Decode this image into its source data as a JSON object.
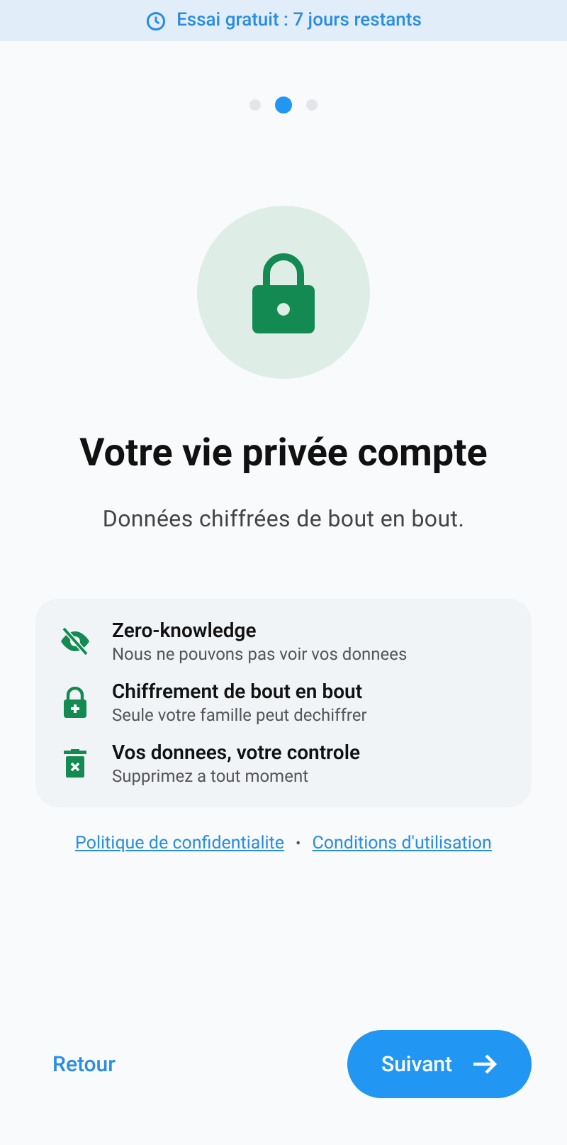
{
  "trial_banner": {
    "text": "Essai gratuit : 7 jours restants"
  },
  "pager": [
    {
      "selected": false
    },
    {
      "selected": true
    },
    {
      "selected": false
    }
  ],
  "title": "Votre vie privée compte",
  "subtitle": "Données chiffrées de bout en bout.",
  "features": [
    {
      "kind": "eye-off",
      "title": "Zero-knowledge",
      "description": "Nous ne pouvons pas voir vos donnees"
    },
    {
      "kind": "lock-plus",
      "title": "Chiffrement de bout en bout",
      "description": "Seule votre famille peut dechiffrer"
    },
    {
      "kind": "trash",
      "title": "Vos donnees, votre controle",
      "description": "Supprimez a tout moment"
    }
  ],
  "links": [
    "Politique de confidentialite",
    "Conditions d'utilisation"
  ],
  "separator": "•",
  "back_button": "Retour",
  "next_button": "Suivant"
}
